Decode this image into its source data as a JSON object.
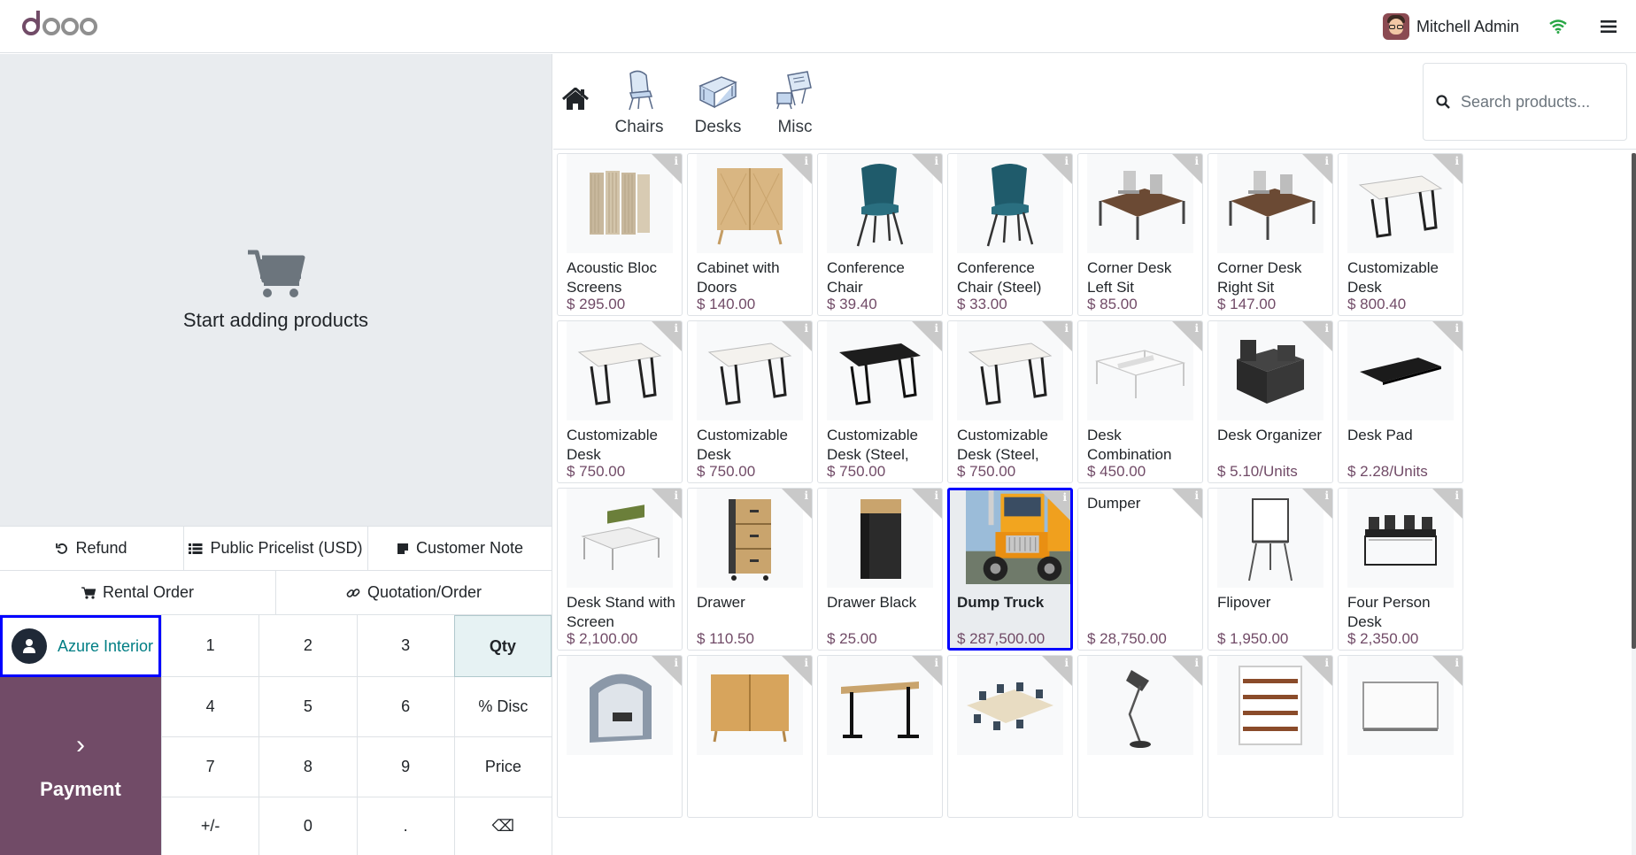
{
  "header": {
    "logo_text": "odoo",
    "user_name": "Mitchell Admin"
  },
  "order": {
    "empty_text": "Start adding products"
  },
  "controls": {
    "refund": "Refund",
    "pricelist": "Public Pricelist (USD)",
    "customer_note": "Customer Note",
    "rental_order": "Rental Order",
    "quotation_order": "Quotation/Order"
  },
  "customer": {
    "name": "Azure Interior"
  },
  "payment": {
    "label": "Payment"
  },
  "numpad": [
    "1",
    "2",
    "3",
    "Qty",
    "4",
    "5",
    "6",
    "% Disc",
    "7",
    "8",
    "9",
    "Price",
    "+/-",
    "0",
    ".",
    "⌫"
  ],
  "categories": [
    {
      "label": "Chairs"
    },
    {
      "label": "Desks"
    },
    {
      "label": "Misc"
    }
  ],
  "search": {
    "placeholder": "Search products..."
  },
  "products": [
    {
      "name": "Acoustic Bloc Screens",
      "price": "$ 295.00",
      "img": "screen"
    },
    {
      "name": "Cabinet with Doors",
      "price": "$ 140.00",
      "img": "cabinet"
    },
    {
      "name": "Conference Chair (Aluminium)",
      "price": "$ 39.40",
      "img": "chair"
    },
    {
      "name": "Conference Chair (Steel)",
      "price": "$ 33.00",
      "img": "chair"
    },
    {
      "name": "Corner Desk Left Sit",
      "price": "$ 85.00",
      "img": "cornerdesk"
    },
    {
      "name": "Corner Desk Right Sit",
      "price": "$ 147.00",
      "img": "cornerdesk"
    },
    {
      "name": "Customizable Desk (Aluminium…",
      "price": "$ 800.40",
      "img": "desk-white"
    },
    {
      "name": "Customizable Desk (Custom,…",
      "price": "$ 750.00",
      "img": "desk-white"
    },
    {
      "name": "Customizable Desk (Custom,…",
      "price": "$ 750.00",
      "img": "desk-white"
    },
    {
      "name": "Customizable Desk (Steel, Black)",
      "price": "$ 750.00",
      "img": "desk-black"
    },
    {
      "name": "Customizable Desk (Steel, White)",
      "price": "$ 750.00",
      "img": "desk-white"
    },
    {
      "name": "Desk Combination",
      "price": "$ 450.00",
      "img": "combo"
    },
    {
      "name": "Desk Organizer",
      "price": "$ 5.10/Units",
      "img": "organizer"
    },
    {
      "name": "Desk Pad",
      "price": "$ 2.28/Units",
      "img": "pad"
    },
    {
      "name": "Desk Stand with Screen",
      "price": "$ 2,100.00",
      "img": "stand"
    },
    {
      "name": "Drawer",
      "price": "$ 110.50",
      "img": "drawer"
    },
    {
      "name": "Drawer Black",
      "price": "$ 25.00",
      "img": "drawerblack"
    },
    {
      "name": "Dump Truck",
      "price": "$ 287,500.00",
      "img": "truck"
    },
    {
      "name": "Dumper",
      "price": "$ 28,750.00",
      "img": "none"
    },
    {
      "name": "Flipover",
      "price": "$ 1,950.00",
      "img": "flip"
    },
    {
      "name": "Four Person Desk",
      "price": "$ 2,350.00",
      "img": "fourdesk"
    },
    {
      "name": "",
      "price": "",
      "img": "pod"
    },
    {
      "name": "",
      "price": "",
      "img": "cabinet2"
    },
    {
      "name": "",
      "price": "",
      "img": "standdesk"
    },
    {
      "name": "",
      "price": "",
      "img": "meeting"
    },
    {
      "name": "",
      "price": "",
      "img": "lamp"
    },
    {
      "name": "",
      "price": "",
      "img": "shelf"
    },
    {
      "name": "",
      "price": "",
      "img": "board"
    }
  ],
  "colors": {
    "brand": "#714b67",
    "accent": "#017e84",
    "highlight": "#0000ff"
  }
}
